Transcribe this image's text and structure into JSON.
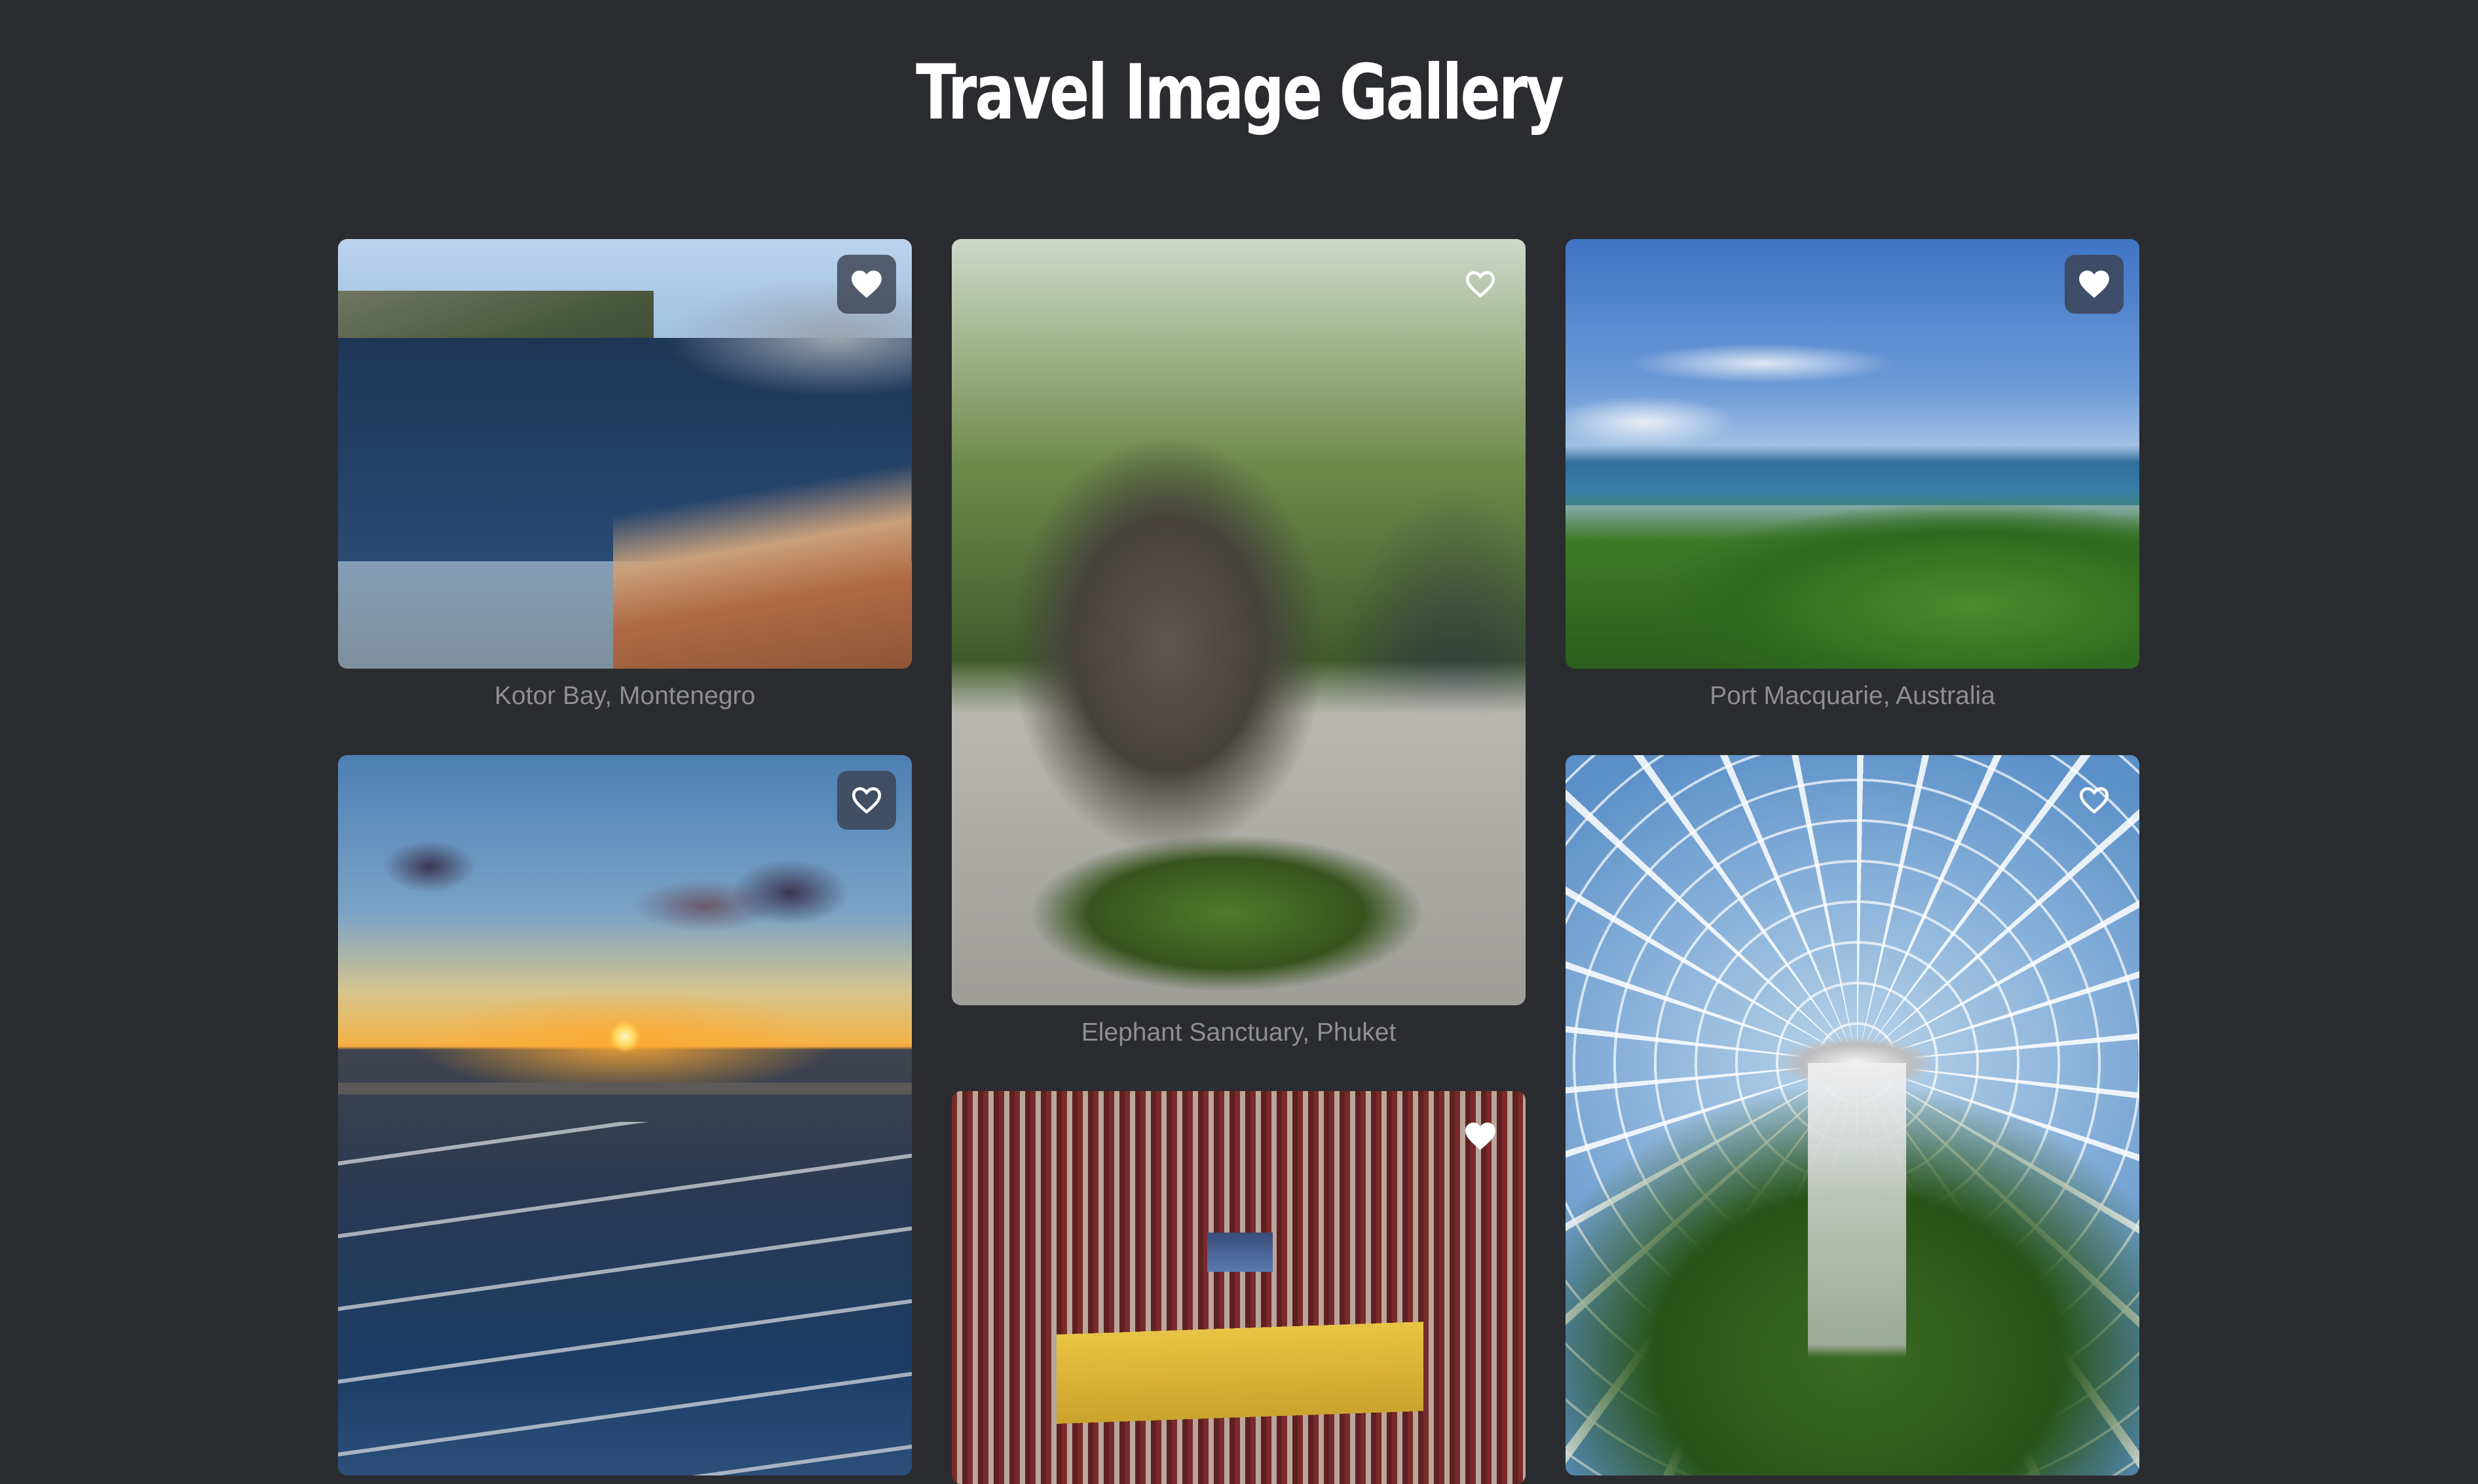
{
  "page": {
    "title": "Travel Image Gallery"
  },
  "gallery": {
    "items": [
      {
        "caption": "Kotor Bay, Montenegro",
        "image_alt": "Kotor bay coastline with mountains and cruise ships",
        "favorite": true,
        "favorite_icon": "heart-filled-icon"
      },
      {
        "caption": "Elephant Sanctuary, Phuket",
        "image_alt": "Man feeding an elephant watermelon at a sanctuary",
        "favorite": false,
        "favorite_icon": "heart-outline-icon"
      },
      {
        "caption": "Port Macquarie, Australia",
        "image_alt": "Green coastal headland with ocean and lighthouse",
        "favorite": true,
        "favorite_icon": "heart-filled-icon"
      },
      {
        "caption": "",
        "image_alt": "Sunset over the ocean seen from a ship deck railing",
        "favorite": false,
        "favorite_icon": "heart-outline-icon"
      },
      {
        "caption": "",
        "image_alt": "Basketball arena viewed from the upper stands",
        "favorite": true,
        "favorite_icon": "heart-filled-icon"
      },
      {
        "caption": "",
        "image_alt": "Indoor waterfall under a glass dome surrounded by trees",
        "favorite": false,
        "favorite_icon": "heart-outline-icon"
      }
    ]
  },
  "colors": {
    "background": "#2b2c30",
    "title": "#ffffff",
    "caption": "#8e8f94",
    "favorite_button": "#3a4252"
  }
}
